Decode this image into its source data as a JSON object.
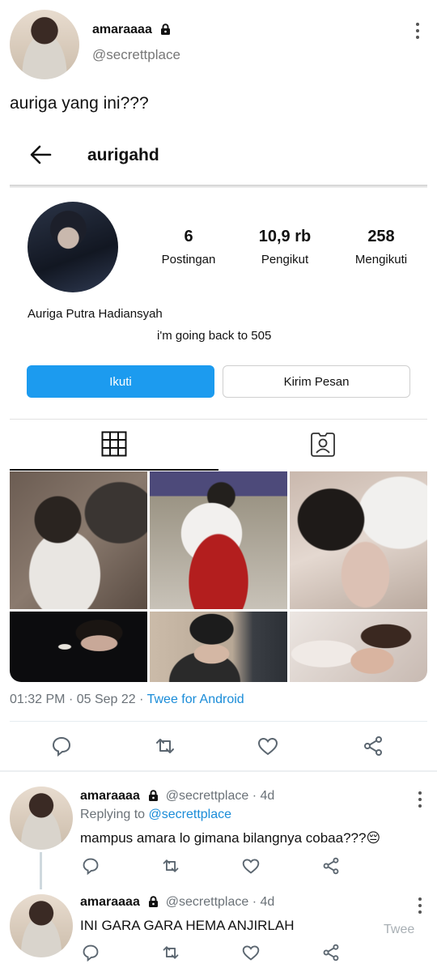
{
  "tweet": {
    "display_name": "amaraaaa",
    "handle": "@secrettplace",
    "text": "auriga yang ini???",
    "timestamp": "01:32 PM",
    "date": "05 Sep 22",
    "separator": "·",
    "client": "Twee for Android"
  },
  "embedded_profile": {
    "username": "aurigahd",
    "stats": [
      {
        "value": "6",
        "label": "Postingan"
      },
      {
        "value": "10,9 rb",
        "label": "Pengikut"
      },
      {
        "value": "258",
        "label": "Mengikuti"
      }
    ],
    "full_name": "Auriga Putra Hadiansyah",
    "bio": "i'm going back to 505",
    "follow_label": "Ikuti",
    "message_label": "Kirim Pesan"
  },
  "replies": [
    {
      "display_name": "amaraaaa",
      "handle": "@secrettplace",
      "age": "4d",
      "separator": "·",
      "replying_prefix": "Replying to",
      "replying_handle": "@secrettplace",
      "text": "mampus amara lo gimana bilangnya cobaa???",
      "emoji": "😔"
    },
    {
      "display_name": "amaraaaa",
      "handle": "@secrettplace",
      "age": "4d",
      "separator": "·",
      "text": "INI GARA GARA HEMA ANJIRLAH",
      "watermark": "Twee"
    }
  ],
  "colors": {
    "link": "#1a8cd8",
    "follow_button": "#1c9bef",
    "icon_gray": "#5b6670"
  }
}
